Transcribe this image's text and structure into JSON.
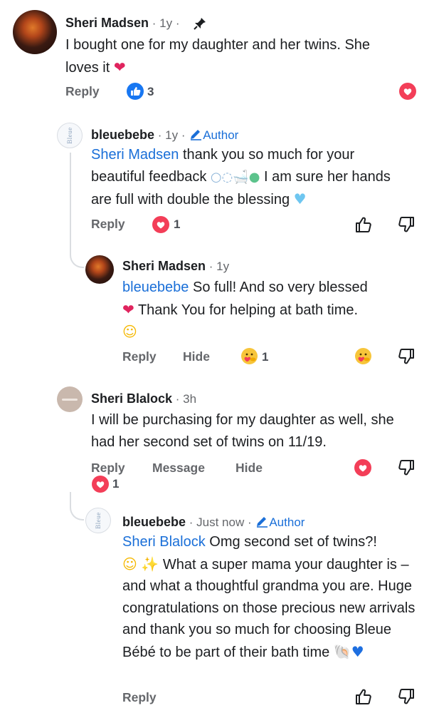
{
  "comments": [
    {
      "author": "Sheri Madsen",
      "time": "1y",
      "text": "I bought one for my daughter and her twins. She loves it",
      "emoji_end": "❤️",
      "actions": {
        "reply": "Reply"
      },
      "like_count": "3"
    },
    {
      "author": "bleuebebe",
      "time": "1y",
      "author_badge": "Author",
      "mention": "Sheri Madsen",
      "text_a": " thank you so much for your beautiful feedback ",
      "text_b": " I am sure her hands are full with double the blessing",
      "actions": {
        "reply": "Reply"
      },
      "love_count": "1"
    },
    {
      "author": "Sheri Madsen",
      "time": "1y",
      "mention": "bleuebebe",
      "text_a": " So full!  And so very blessed",
      "text_b": " Thank You for helping at bath time.",
      "actions": {
        "reply": "Reply",
        "hide": "Hide"
      },
      "care_count": "1"
    },
    {
      "author": "Sheri Blalock",
      "time": "3h",
      "text": "I will be purchasing for my daughter as well, she had her second set of twins on 11/19.",
      "actions": {
        "reply": "Reply",
        "message": "Message",
        "hide": "Hide"
      },
      "love_count": "1"
    },
    {
      "author": "bleuebebe",
      "time": "Just now",
      "author_badge": "Author",
      "mention": "Sheri Blalock",
      "text_a": " Omg second set of twins?!",
      "text_b": " What a super mama your daughter is – and what a thoughtful grandma you are. Huge congratulations on those precious new arrivals and thank you so much for choosing Bleue Bébé to be part of their bath time",
      "actions": {
        "reply": "Reply"
      }
    }
  ],
  "avatar_logo_text": "Bleue",
  "colors": {
    "accent": "#1a6fd8",
    "love": "#e0245e",
    "like": "#1877f2",
    "thread": "#dadde1"
  },
  "icons": [
    "pin-icon",
    "pencil-icon",
    "like-icon",
    "love-icon",
    "care-icon",
    "thumbs-up-outline-icon",
    "thumbs-down-outline-icon"
  ]
}
